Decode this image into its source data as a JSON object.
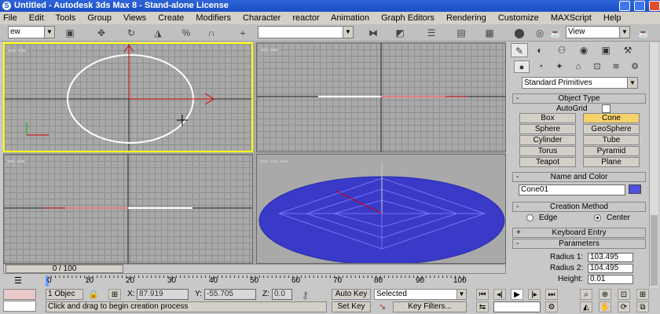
{
  "window": {
    "title": "Untitled - Autodesk 3ds Max 8 - Stand-alone License"
  },
  "menu": [
    "File",
    "Edit",
    "Tools",
    "Group",
    "Views",
    "Create",
    "Modifiers",
    "Character",
    "reactor",
    "Animation",
    "Graph Editors",
    "Rendering",
    "Customize",
    "MAXScript",
    "Help"
  ],
  "toolbar": {
    "selection_filter": "ew",
    "named_selection": "",
    "view_dropdown": "View"
  },
  "panel": {
    "category": "Standard Primitives",
    "object_type": {
      "title": "Object Type",
      "autogrid_label": "AutoGrid",
      "buttons": [
        "Box",
        "Cone",
        "Sphere",
        "GeoSphere",
        "Cylinder",
        "Tube",
        "Torus",
        "Pyramid",
        "Teapot",
        "Plane"
      ],
      "selected": "Cone"
    },
    "name_color": {
      "title": "Name and Color",
      "name": "Cone01",
      "color": "#5050e0"
    },
    "creation_method": {
      "title": "Creation Method",
      "edge_label": "Edge",
      "center_label": "Center"
    },
    "keyboard_entry": {
      "title": "Keyboard Entry"
    },
    "parameters": {
      "title": "Parameters",
      "radius1_label": "Radius 1:",
      "radius1": "103.495",
      "radius2_label": "Radius 2:",
      "radius2": "104.495",
      "height_label": "Height:",
      "height": "0.01"
    }
  },
  "timeline": {
    "frame_display": "0 / 100",
    "ticks": [
      "0",
      "10",
      "20",
      "30",
      "40",
      "50",
      "60",
      "70",
      "80",
      "90",
      "100"
    ],
    "progress": 0.0
  },
  "status": {
    "selection_count": "1 Objec",
    "x_label": "X:",
    "x": "87.919",
    "y_label": "Y:",
    "y": "-55.705",
    "z_label": "Z:",
    "z": "0.0",
    "prompt": "Click and drag to begin creation process",
    "auto_key": "Auto Key",
    "set_key": "Set Key",
    "key_mode": "Selected",
    "key_filters": "Key Filters..."
  }
}
